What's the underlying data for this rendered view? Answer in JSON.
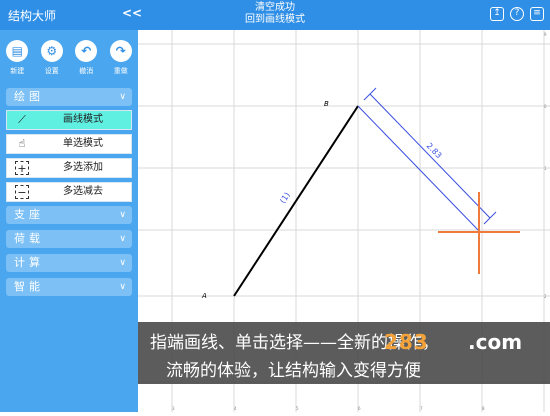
{
  "header": {
    "app_title": "结构大师",
    "collapse": "<<",
    "status_line1": "清空成功",
    "status_line2": "回到画线模式"
  },
  "toolbar": [
    {
      "label": "新建",
      "glyph": "▤"
    },
    {
      "label": "设置",
      "glyph": "⚙"
    },
    {
      "label": "撤消",
      "glyph": "↶"
    },
    {
      "label": "重做",
      "glyph": "↷"
    }
  ],
  "categories": {
    "draw": "绘图",
    "support": "支座",
    "load": "荷载",
    "calc": "计算",
    "smart": "智能",
    "chevron": "∨"
  },
  "modes": [
    {
      "label": "画线模式",
      "glyph": "⟋",
      "active": true
    },
    {
      "label": "单选模式",
      "glyph": "☝",
      "active": false
    },
    {
      "label": "多选添加",
      "glyph": "+",
      "active": false
    },
    {
      "label": "多选减去",
      "glyph": "−",
      "active": false
    }
  ],
  "canvas": {
    "node_a": "A",
    "node_b": "B",
    "member_label": "(1)",
    "dimension": "2.83",
    "ruler_ticks": [
      "3",
      "4",
      "5",
      "6",
      "7",
      "8",
      "9",
      "0",
      "1",
      "2"
    ]
  },
  "banner": {
    "line1": "指端画线、单击选择——全新的操作，",
    "line2": "流畅的体验，让结构输入变得方便",
    "watermark": "283",
    "watermark2": ".com"
  },
  "colors": {
    "header": "#2f8fe6",
    "sidebar": "#4aa6ef",
    "active_mode": "#5ff0e2",
    "dimension": "#3a4fe0",
    "cursor": "#f07a3a"
  }
}
